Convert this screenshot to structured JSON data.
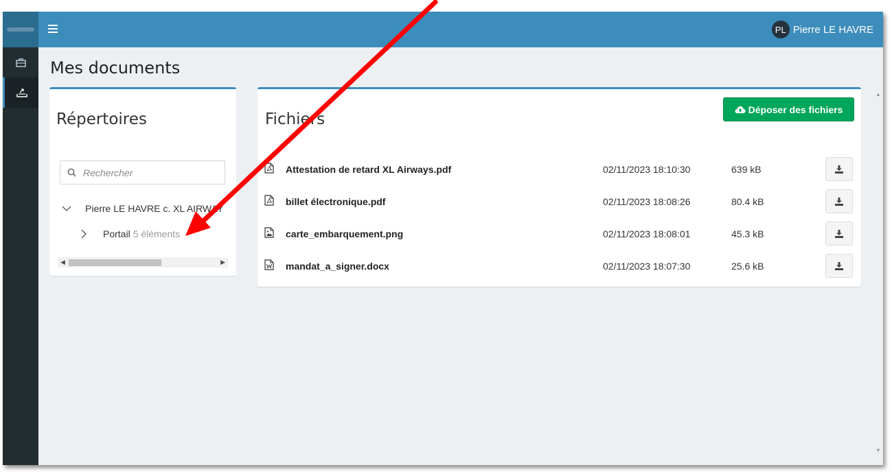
{
  "header": {
    "logo_icon": "app-logo",
    "menu_icon": "hamburger-icon",
    "user_initials": "PL",
    "user_name": "Pierre LE HAVRE"
  },
  "sidebar": {
    "items": [
      {
        "icon": "briefcase-icon",
        "active": false
      },
      {
        "icon": "inbox-upload-icon",
        "active": true
      }
    ]
  },
  "page": {
    "title": "Mes documents"
  },
  "repertoires": {
    "title": "Répertoires",
    "search_placeholder": "Rechercher",
    "tree": [
      {
        "label": "Pierre LE HAVRE c. XL AIRWAY",
        "expanded": true,
        "level": 0
      },
      {
        "label": "Portail",
        "count": "5 éléments",
        "expanded": false,
        "level": 1
      }
    ]
  },
  "fichiers": {
    "title": "Fichiers",
    "upload_label": "Déposer des fichiers",
    "files": [
      {
        "name": "Attestation de retard XL Airways.pdf",
        "date": "02/11/2023 18:10:30",
        "size": "639 kB",
        "icon": "pdf-file-icon"
      },
      {
        "name": "billet électronique.pdf",
        "date": "02/11/2023 18:08:26",
        "size": "80.4 kB",
        "icon": "pdf-file-icon"
      },
      {
        "name": "carte_embarquement.png",
        "date": "02/11/2023 18:08:01",
        "size": "45.3 kB",
        "icon": "image-file-icon"
      },
      {
        "name": "mandat_a_signer.docx",
        "date": "02/11/2023 18:07:30",
        "size": "25.6 kB",
        "icon": "word-file-icon"
      }
    ]
  },
  "annotation": {
    "arrow_color": "#ff0000"
  },
  "colors": {
    "header": "#3c8dbc",
    "sidebar": "#222d32",
    "upload_button": "#00a65a",
    "background": "#edf0f3"
  }
}
